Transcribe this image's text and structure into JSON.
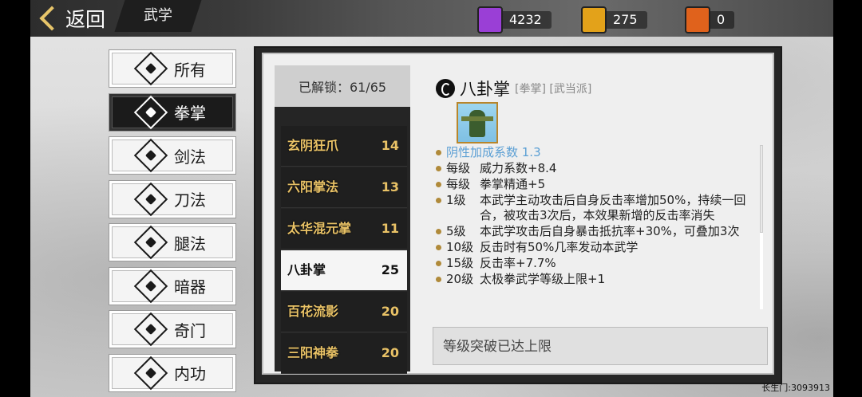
{
  "header": {
    "back_label": "返回",
    "section_title": "武学",
    "resources": [
      {
        "name": "purple-book",
        "value": "4232",
        "color": "#9a3fd6"
      },
      {
        "name": "gold-book",
        "value": "275",
        "color": "#e3a21a"
      },
      {
        "name": "red-book",
        "value": "0",
        "color": "#e0621c"
      }
    ]
  },
  "categories": [
    {
      "label": "所有",
      "icon": "all-icon"
    },
    {
      "label": "拳掌",
      "icon": "fist-icon",
      "active": true
    },
    {
      "label": "剑法",
      "icon": "sword-icon"
    },
    {
      "label": "刀法",
      "icon": "blade-icon"
    },
    {
      "label": "腿法",
      "icon": "leg-icon"
    },
    {
      "label": "暗器",
      "icon": "shuriken-icon"
    },
    {
      "label": "奇门",
      "icon": "exotic-icon"
    },
    {
      "label": "内功",
      "icon": "inner-power-icon"
    }
  ],
  "skill_list": {
    "unlocked_label": "已解锁：61/65",
    "items": [
      {
        "name": "玄阴狂爪",
        "level": "14"
      },
      {
        "name": "六阳掌法",
        "level": "13"
      },
      {
        "name": "太华混元掌",
        "level": "11"
      },
      {
        "name": "八卦掌",
        "level": "25",
        "selected": true
      },
      {
        "name": "百花流影",
        "level": "20"
      },
      {
        "name": "三阳神拳",
        "level": "20"
      }
    ]
  },
  "detail": {
    "name": "八卦掌",
    "tags": "[拳掌] [武当派]",
    "effects": [
      {
        "level": "",
        "text": "阴性加成系数 1.3",
        "highlight": true
      },
      {
        "level": "每级",
        "text": "威力系数+8.4"
      },
      {
        "level": "每级",
        "text": "拳掌精通+5"
      },
      {
        "level": "1级",
        "text": "本武学主动攻击后自身反击率增加50%，持续一回合，被攻击3次后，本效果新增的反击率消失"
      },
      {
        "level": "5级",
        "text": "本武学攻击后自身暴击抵抗率+30%，可叠加3次"
      },
      {
        "level": "10级",
        "text": "反击时有50%几率发动本武学"
      },
      {
        "level": "15级",
        "text": "反击率+7.7%"
      },
      {
        "level": "20级",
        "text": "太极拳武学等级上限+1"
      }
    ],
    "limit_text": "等级突破已达上限"
  },
  "footer": {
    "watermark": "长生门:3093913"
  }
}
